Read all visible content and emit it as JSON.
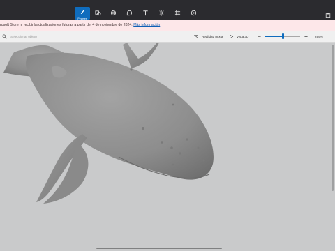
{
  "toolbar": {
    "brushes_label": "Pinceles"
  },
  "banner": {
    "message": "rosoft Store ni recibirá actualizaciones futuras a partir del 4 de noviembre de 2024.",
    "link": "Más información"
  },
  "view_toolbar": {
    "search_placeholder": "Seleccionar objeto",
    "mixed_reality_label": "Realidad mixta",
    "view_3d_label": "Vista 3D",
    "zoom_value": "299%",
    "zoom_fraction": 0.5,
    "more_label": "···"
  },
  "colors": {
    "accent": "#0f6cbd",
    "topbar": "#2b2b2f",
    "banner": "#fde7e9",
    "canvas": "#c9cacb",
    "model": "#8b8b8b"
  }
}
